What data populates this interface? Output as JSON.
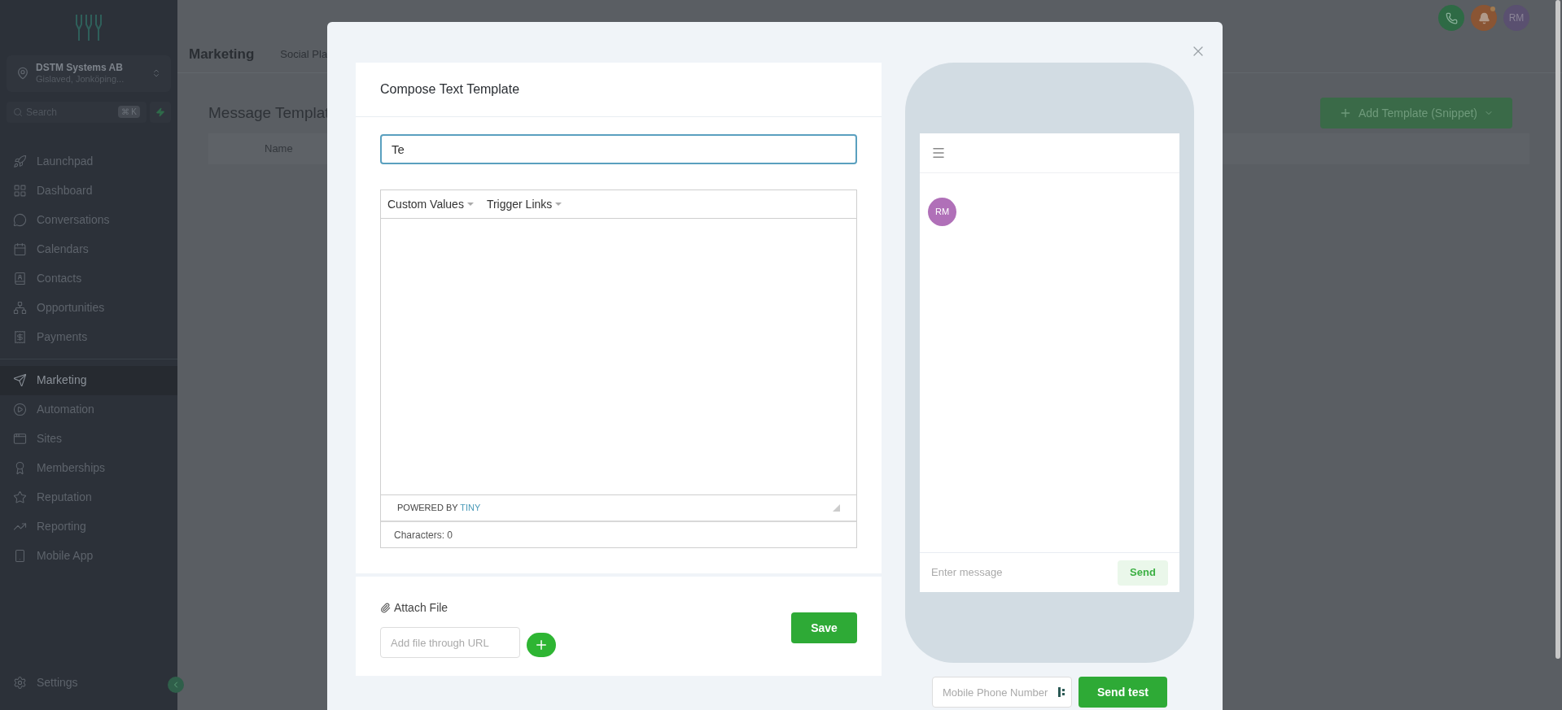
{
  "sidebar": {
    "account": {
      "name": "DSTM Systems AB",
      "location": "Gislaved, Jonköping..."
    },
    "search": {
      "placeholder": "Search",
      "shortcut": "⌘ K"
    },
    "nav_groups": [
      [
        {
          "label": "Launchpad",
          "selected": false
        },
        {
          "label": "Dashboard",
          "selected": false
        },
        {
          "label": "Conversations",
          "selected": false
        },
        {
          "label": "Calendars",
          "selected": false
        },
        {
          "label": "Contacts",
          "selected": false
        },
        {
          "label": "Opportunities",
          "selected": false
        },
        {
          "label": "Payments",
          "selected": false
        }
      ],
      [
        {
          "label": "Marketing",
          "selected": true
        },
        {
          "label": "Automation",
          "selected": false
        },
        {
          "label": "Sites",
          "selected": false
        },
        {
          "label": "Memberships",
          "selected": false
        },
        {
          "label": "Reputation",
          "selected": false
        },
        {
          "label": "Reporting",
          "selected": false
        },
        {
          "label": "Mobile App",
          "selected": false
        }
      ]
    ],
    "settings": "Settings"
  },
  "topbar": {
    "avatar": "RM",
    "notification_dot": true
  },
  "header": {
    "title": "Marketing",
    "tabs": [
      "Social Pla"
    ]
  },
  "page": {
    "title": "Message Templat",
    "add_button": "Add Template (Snippet)",
    "table": {
      "columns": [
        "Name"
      ]
    }
  },
  "modal": {
    "editor": {
      "title": "Compose Text Template",
      "name_value": "Te",
      "toolbar": [
        "Custom Values",
        "Trigger Links"
      ],
      "powered_by": "POWERED BY **TINY**",
      "characters": "Characters: 0"
    },
    "attach": {
      "label": "Attach File",
      "url_placeholder": "Add file through URL",
      "save": "Save"
    },
    "preview": {
      "avatar": "RM",
      "message_placeholder": "Enter message",
      "send": "Send",
      "phone_placeholder": "Mobile Phone Number",
      "send_test": "Send test"
    }
  }
}
